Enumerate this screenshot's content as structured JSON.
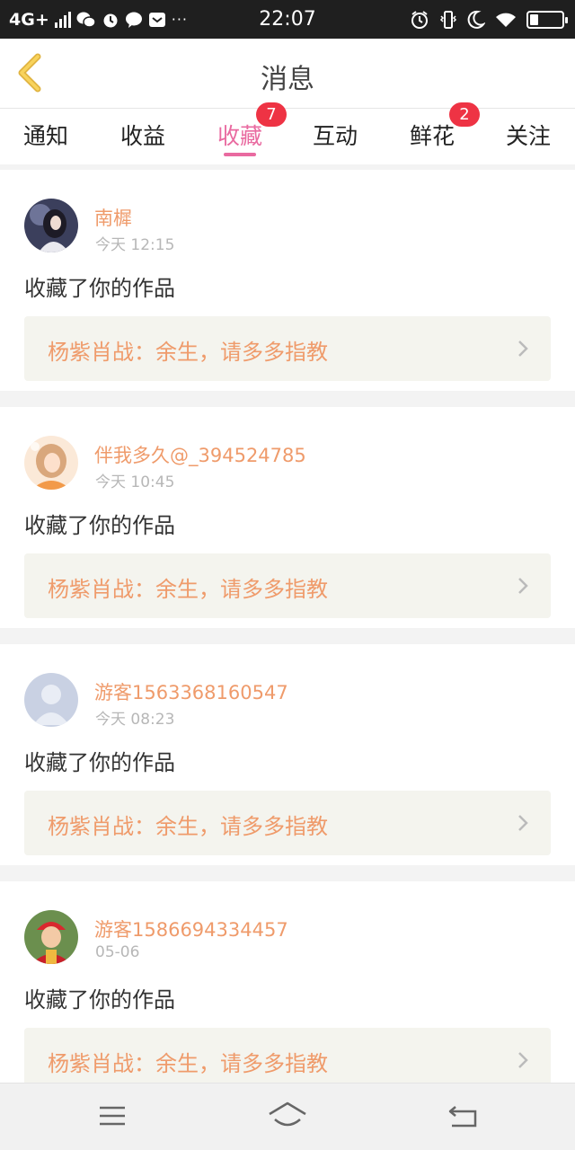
{
  "status_bar": {
    "network": "4G+",
    "time": "22:07",
    "dots": "···",
    "left_icons": [
      "signal-icon",
      "wechat-icon",
      "alarm-icon",
      "chat-icon",
      "mail-icon"
    ],
    "right_icons": [
      "alarm-icon",
      "vibrate-icon",
      "moon-icon",
      "wifi-icon",
      "battery-icon"
    ],
    "battery_level": 0.25
  },
  "header": {
    "title": "消息",
    "back_icon": "chevron-left-icon",
    "colors": {
      "back": "#f2c24b",
      "title": "#444444"
    }
  },
  "tabs": {
    "items": [
      {
        "label": "通知",
        "badge": ""
      },
      {
        "label": "收益",
        "badge": ""
      },
      {
        "label": "收藏",
        "badge": "7",
        "active": true
      },
      {
        "label": "互动",
        "badge": ""
      },
      {
        "label": "鲜花",
        "badge": "2"
      },
      {
        "label": "关注",
        "badge": ""
      }
    ],
    "colors": {
      "active": "#e96aa0",
      "badge": "#ee3344"
    }
  },
  "messages": [
    {
      "user": "南樨",
      "time": "今天 12:15",
      "action": "收藏了你的作品",
      "work": "杨紫肖战：余生，请多多指教"
    },
    {
      "user": "伴我多久@_394524785",
      "time": "今天 10:45",
      "action": "收藏了你的作品",
      "work": "杨紫肖战：余生，请多多指教"
    },
    {
      "user": "游客1563368160547",
      "time": "今天 08:23",
      "action": "收藏了你的作品",
      "work": "杨紫肖战：余生，请多多指教"
    },
    {
      "user": "游客1586694334457",
      "time": "05-06",
      "action": "收藏了你的作品",
      "work": "杨紫肖战：余生，请多多指教"
    }
  ],
  "nav_bar": {
    "icons": [
      "menu-icon",
      "home-icon",
      "back-icon"
    ]
  },
  "colors": {
    "username": "#ef9b6b",
    "work_link_bg": "#f4f4ee"
  }
}
